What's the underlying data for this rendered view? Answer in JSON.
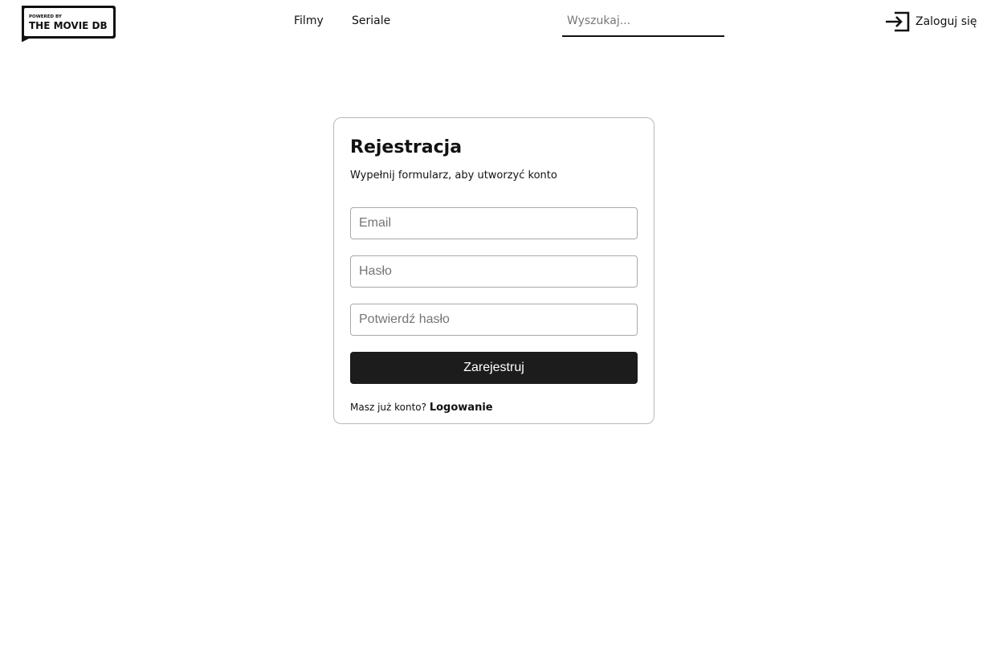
{
  "header": {
    "logo": {
      "top_text": "POWERED BY",
      "main_text": "THE MOVIE DB"
    },
    "nav": [
      {
        "label": "Filmy"
      },
      {
        "label": "Seriale"
      }
    ],
    "search": {
      "placeholder": "Wyszukaj...",
      "value": ""
    },
    "login": {
      "label": "Zaloguj się",
      "icon": "login-icon"
    }
  },
  "register": {
    "title": "Rejestracja",
    "subtitle": "Wypełnij formularz, aby utworzyć konto",
    "fields": {
      "email": {
        "placeholder": "Email",
        "value": ""
      },
      "password": {
        "placeholder": "Hasło",
        "value": ""
      },
      "confirm": {
        "placeholder": "Potwierdź hasło",
        "value": ""
      }
    },
    "submit_label": "Zarejestruj",
    "footer": {
      "prompt": "Masz już konto?",
      "link_label": "Logowanie"
    }
  },
  "colors": {
    "accent": "#1c1c1c",
    "card_border": "#b9b9b9",
    "input_border": "#a9a9a9"
  }
}
